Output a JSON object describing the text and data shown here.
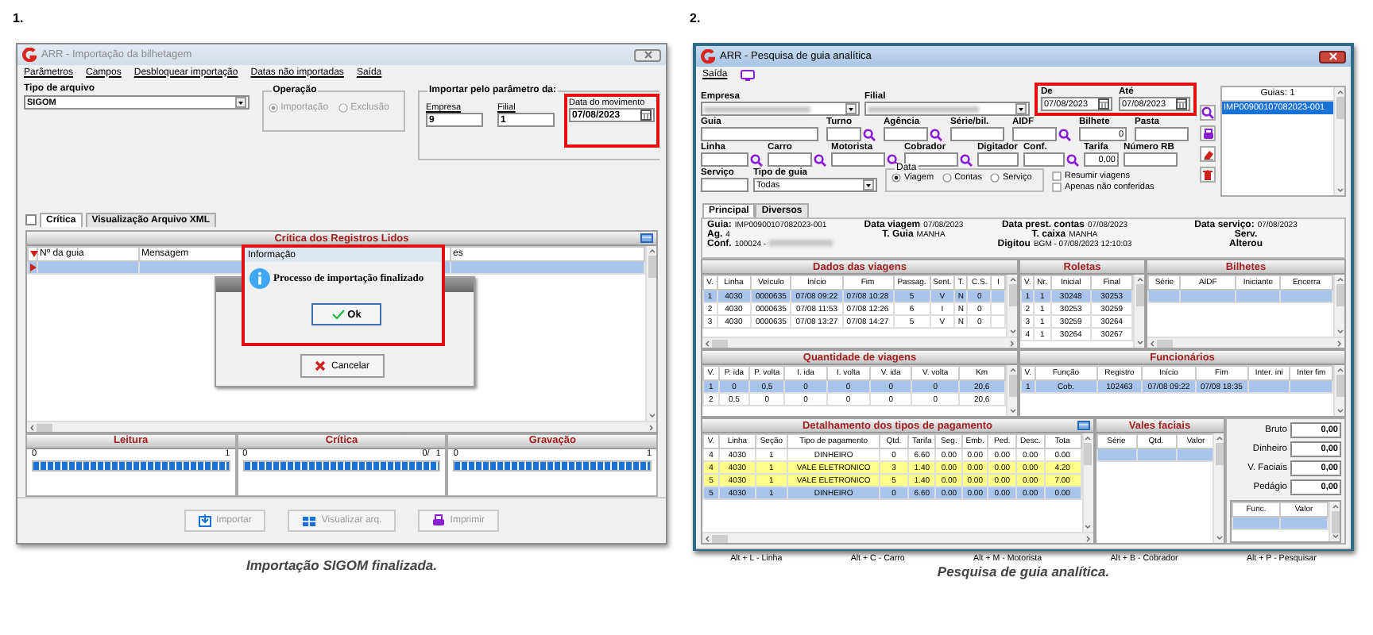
{
  "figure_1": {
    "number": "1.",
    "caption": "Importação SIGOM finalizada.",
    "window": {
      "title": "ARR - Importação da bilhetagem",
      "active": false,
      "menu": [
        "Parâmetros",
        "Campos",
        "Desbloquear importação",
        "Datas não importadas",
        "Saída"
      ],
      "file_type": {
        "label": "Tipo de arquivo",
        "value": "SIGOM"
      },
      "operation": {
        "label": "Operação",
        "disabled": true,
        "options": [
          {
            "label": "Importação",
            "selected": true
          },
          {
            "label": "Exclusão",
            "selected": false
          }
        ]
      },
      "import_by": {
        "label": "Importar pelo parâmetro da:",
        "fields": [
          {
            "label": "Empresa",
            "value": "9",
            "highlighted": false
          },
          {
            "label": "Filial",
            "value": "1",
            "highlighted": false
          },
          {
            "label": "Data do movimento",
            "value": "07/08/2023",
            "highlighted": true
          }
        ]
      },
      "tabs": [
        {
          "label": "Crítica",
          "selected": true
        },
        {
          "label": "Visualização Arquivo XML",
          "selected": false
        }
      ],
      "grid": {
        "title": "Crítica dos Registros Lidos",
        "columns": [
          "Nº da guia",
          "Mensagem",
          "es"
        ],
        "rows": [
          {
            "selected": true
          }
        ]
      },
      "progress": [
        {
          "label": "Leitura",
          "start": "0",
          "end": "1",
          "level": 1
        },
        {
          "label": "Crítica",
          "start": "0",
          "count": "0/",
          "end": "1",
          "level": 1
        },
        {
          "label": "Gravação",
          "start": "0",
          "end": "1",
          "level": 1
        }
      ],
      "buttons": [
        {
          "label": "Importar",
          "disabled": true
        },
        {
          "label": "Visualizar arq.",
          "disabled": true
        },
        {
          "label": "Imprimir",
          "disabled": true
        }
      ],
      "progress_dialog": {
        "button": "Cancelar"
      },
      "message_dialog": {
        "title": "Informação",
        "message": "Processo de importação finalizado",
        "button": "Ok",
        "highlighted": true
      }
    }
  },
  "figure_2": {
    "number": "2.",
    "caption": "Pesquisa de guia analítica.",
    "window": {
      "title": "ARR - Pesquisa de guia analítica",
      "active": true,
      "menu": [
        "Saída"
      ],
      "filters": [
        [
          {
            "label": "Empresa",
            "kind": "redacted_select"
          },
          {
            "label": "Filial",
            "kind": "redacted_select"
          },
          {
            "kind": "date_range",
            "highlighted": true,
            "fields": [
              {
                "label": "De",
                "value": "07/08/2023"
              },
              {
                "label": "Até",
                "value": "07/08/2023"
              }
            ]
          }
        ],
        [
          {
            "label": "Guia",
            "kind": "text"
          },
          {
            "label": "Turno",
            "kind": "lookup"
          },
          {
            "label": "Agência",
            "kind": "lookup"
          },
          {
            "label": "Série/bil.",
            "kind": "text"
          },
          {
            "label": "AIDF",
            "kind": "lookup"
          },
          {
            "label": "Bilhete",
            "kind": "number",
            "value": "0"
          },
          {
            "label": "Pasta",
            "kind": "text"
          }
        ],
        [
          {
            "label": "Linha",
            "kind": "lookup"
          },
          {
            "label": "Carro",
            "kind": "lookup"
          },
          {
            "label": "Motorista",
            "kind": "lookup"
          },
          {
            "label": "Cobrador",
            "kind": "lookup"
          },
          {
            "label": "Digitador",
            "kind": "text"
          },
          {
            "label": "Conf.",
            "kind": "lookup"
          },
          {
            "label": "Tarifa",
            "kind": "number",
            "value": "0,00"
          },
          {
            "label": "Número RB",
            "kind": "text"
          }
        ],
        [
          {
            "label": "Serviço",
            "kind": "text"
          },
          {
            "label": "Tipo de guia",
            "kind": "select",
            "value": "Todas"
          },
          {
            "label": "Data",
            "kind": "radio_group",
            "options": [
              {
                "label": "Viagem",
                "selected": true
              },
              {
                "label": "Contas",
                "selected": false
              },
              {
                "label": "Serviço",
                "selected": false
              }
            ]
          },
          {
            "kind": "checkboxes",
            "options": [
              {
                "label": "Resumir viagens",
                "checked": false
              },
              {
                "label": "Apenas não conferidas",
                "checked": false
              }
            ]
          }
        ]
      ],
      "guides": {
        "header": "Guias: 1",
        "items": [
          {
            "label": "IMP00900107082023-001",
            "selected": true
          }
        ]
      },
      "tabs": [
        {
          "label": "Principal",
          "selected": true
        },
        {
          "label": "Diversos",
          "selected": false
        }
      ],
      "info": [
        [
          {
            "label": "Guia:",
            "value": "IMP00900107082023-001"
          },
          {
            "label": "Ag.",
            "value": "4"
          },
          {
            "label": "Conf.",
            "value": "100024 -",
            "redacted": true
          }
        ],
        [
          {
            "label": "Data viagem",
            "value": "07/08/2023"
          },
          {
            "label": "T. Guia",
            "value": "MANHA"
          }
        ],
        [
          {
            "label": "Data prest. contas",
            "value": "07/08/2023"
          },
          {
            "label": "T. caixa",
            "value": "MANHA"
          },
          {
            "label": "Digitou",
            "value": "BGM - 07/08/2023 12:10:03"
          }
        ],
        [
          {
            "label": "Data serviço:",
            "value": "07/08/2023"
          },
          {
            "label": "Serv."
          },
          {
            "label": "Alterou"
          }
        ]
      ],
      "trips": {
        "title": "Dados das viagens",
        "columns": [
          "V.",
          "Linha",
          "Veículo",
          "Início",
          "Fim",
          "Passag.",
          "Sent.",
          "T.",
          "C.S.",
          "I"
        ],
        "rows": [
          {
            "cells": [
              "1",
              "4030",
              "0000635",
              "07/08 09:22",
              "07/08 10:28",
              "5",
              "V",
              "N",
              "0",
              ""
            ],
            "selected": true
          },
          {
            "cells": [
              "2",
              "4030",
              "0000635",
              "07/08 11:53",
              "07/08 12:26",
              "6",
              "I",
              "N",
              "0",
              ""
            ],
            "selected": false
          },
          {
            "cells": [
              "3",
              "4030",
              "0000635",
              "07/08 13:27",
              "07/08 14:27",
              "5",
              "V",
              "N",
              "0",
              ""
            ],
            "selected": false
          }
        ]
      },
      "turnstiles": {
        "title": "Roletas",
        "columns": [
          "V.",
          "Nr.",
          "Inicial",
          "Final"
        ],
        "rows": [
          {
            "cells": [
              "1",
              "1",
              "30248",
              "30253"
            ],
            "selected": true
          },
          {
            "cells": [
              "2",
              "1",
              "30253",
              "30259"
            ],
            "selected": false
          },
          {
            "cells": [
              "3",
              "1",
              "30259",
              "30264"
            ],
            "selected": false
          },
          {
            "cells": [
              "4",
              "1",
              "30264",
              "30267"
            ],
            "selected": false
          }
        ]
      },
      "tickets": {
        "title": "Bilhetes",
        "columns": [
          "Série",
          "AIDF",
          "Iniciante",
          "Encerra"
        ],
        "rows": [
          {
            "selected": true
          }
        ]
      },
      "trip_counts": {
        "title": "Quantidade de viagens",
        "columns": [
          "V.",
          "P. ida",
          "P. volta",
          "I. ida",
          "I. volta",
          "V. ida",
          "V. volta",
          "Km"
        ],
        "rows": [
          {
            "cells": [
              "1",
              "0",
              "0,5",
              "0",
              "0",
              "0",
              "0",
              "20,6"
            ],
            "selected": true
          },
          {
            "cells": [
              "2",
              "0,5",
              "0",
              "0",
              "0",
              "0",
              "0",
              "20,6"
            ],
            "selected": false
          }
        ]
      },
      "staff": {
        "title": "Funcionários",
        "columns": [
          "V.",
          "Função",
          "Registro",
          "Início",
          "Fim",
          "Inter. ini",
          "Inter fim"
        ],
        "rows": [
          {
            "cells": [
              "1",
              "Cob.",
              "102463",
              "07/08 09:22",
              "07/08 18:35",
              "",
              ""
            ],
            "selected": true
          }
        ]
      },
      "payments": {
        "title": "Detalhamento dos tipos de pagamento",
        "columns": [
          "V.",
          "Linha",
          "Seção",
          "Tipo de pagamento",
          "Qtd.",
          "Tarifa",
          "Seg.",
          "Emb.",
          "Ped.",
          "Desc.",
          "Tota"
        ],
        "rows": [
          {
            "cells": [
              "4",
              "4030",
              "1",
              "DINHEIRO",
              "0",
              "6.60",
              "0.00",
              "0.00",
              "0.00",
              "0.00",
              "0.00"
            ],
            "selected": false,
            "highlighted": false
          },
          {
            "cells": [
              "4",
              "4030",
              "1",
              "VALE ELETRONICO",
              "3",
              "1.40",
              "0.00",
              "0.00",
              "0.00",
              "0.00",
              "4.20"
            ],
            "selected": false,
            "highlighted": true
          },
          {
            "cells": [
              "5",
              "4030",
              "1",
              "VALE ELETRONICO",
              "5",
              "1.40",
              "0.00",
              "0.00",
              "0.00",
              "0.00",
              "7.00"
            ],
            "selected": false,
            "highlighted": true
          },
          {
            "cells": [
              "5",
              "4030",
              "1",
              "DINHEIRO",
              "0",
              "6.60",
              "0.00",
              "0.00",
              "0.00",
              "0.00",
              "0.00"
            ],
            "selected": true,
            "highlighted": false
          }
        ]
      },
      "face_vouchers": {
        "title": "Vales faciais",
        "columns": [
          "Série",
          "Qtd.",
          "Valor"
        ],
        "rows": [
          {
            "selected": true
          }
        ]
      },
      "totals": [
        {
          "label": "Bruto",
          "value": "0,00"
        },
        {
          "label": "Dinheiro",
          "value": "0,00"
        },
        {
          "label": "V. Faciais",
          "value": "0,00"
        },
        {
          "label": "Pedágio",
          "value": "0,00"
        }
      ],
      "staff_values": {
        "columns": [
          "Func.",
          "Valor"
        ],
        "rows": [
          {
            "selected": true
          }
        ]
      },
      "status_bar": [
        "Alt + L - Linha",
        "Alt + C - Carro",
        "Alt + M - Motorista",
        "Alt + B - Cobrador",
        "Alt + P - Pesquisar"
      ]
    }
  }
}
